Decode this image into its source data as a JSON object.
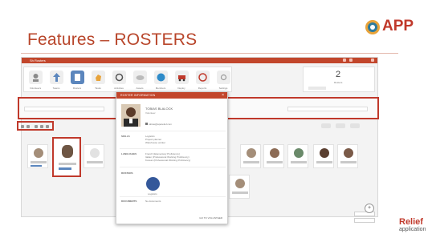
{
  "slide": {
    "title": "Features – ROSTERS",
    "logo": "APP",
    "footer_brand": "Relief",
    "footer_sub": "application"
  },
  "app": {
    "window_title": "Sh Rosters",
    "toolbar": {
      "buttons": [
        {
          "label": "Volunteers",
          "icon": "people-icon"
        },
        {
          "label": "Teams",
          "icon": "upload-icon"
        },
        {
          "label": "Rosters",
          "icon": "rosters-icon"
        },
        {
          "label": "Tasks",
          "icon": "hand-icon"
        },
        {
          "label": "Activities",
          "icon": "refresh-icon"
        },
        {
          "label": "Assets",
          "icon": "cloud-icon"
        },
        {
          "label": "Members",
          "icon": "globe-icon"
        },
        {
          "label": "Deploy",
          "icon": "truck-icon"
        },
        {
          "label": "Reports",
          "icon": "report-icon"
        },
        {
          "label": "Settings",
          "icon": "gear-icon"
        }
      ]
    },
    "counter": {
      "value": "2",
      "label": "Rosters"
    }
  },
  "modal": {
    "title": "ROSTER INFORMATION",
    "close": "×",
    "person_name": "TOBIAS BLALOCK",
    "person_sub": "Volunteer",
    "email": "tobias@aparelief.com",
    "sections": [
      {
        "label": "SKILLS",
        "values": [
          "Logistics",
          "Project planner",
          "Warehouse worker"
        ]
      },
      {
        "label": "LANGUAGES",
        "values": [
          "French (Elementary Proficiency)",
          "Italian (Professional Working Proficiency)",
          "Korean (Professional Working Proficiency)"
        ]
      },
      {
        "label": "ROSTERS",
        "values": []
      },
      {
        "label": "DOCUMENTS",
        "values": [
          "No documents"
        ]
      }
    ],
    "roster_name": "Logistics",
    "footer_action": "GO TO VOLUNTEER"
  },
  "colors": {
    "accent": "#c2462b",
    "outline": "#c0392b",
    "active_button": "#5b86bd",
    "roster": "#34589a"
  }
}
